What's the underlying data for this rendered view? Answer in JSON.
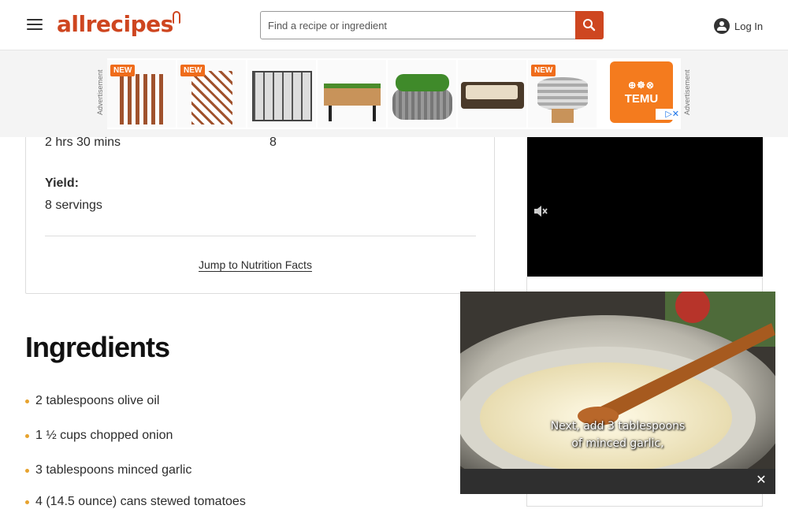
{
  "header": {
    "logo": "allrecipes",
    "search_placeholder": "Find a recipe or ingredient",
    "login_label": "Log In"
  },
  "ad": {
    "side_label": "Advertisement",
    "new_badge": "NEW",
    "brand": "TEMU",
    "brand_icons": "⊕☸⊗",
    "close_glyph": "▷✕",
    "colors": {
      "badge": "#ef6c1b",
      "brand_bg": "#f47b1e"
    }
  },
  "recipe": {
    "total_time_value": "2 hrs 30 mins",
    "servings_value": "8",
    "yield_label": "Yield:",
    "yield_value": "8 servings",
    "jump_link": "Jump to Nutrition Facts"
  },
  "ingredients": {
    "title": "Ingredients",
    "items": [
      "2 tablespoons olive oil",
      "1 ½ cups chopped onion",
      "3 tablespoons minced garlic",
      "4 (14.5 ounce) cans stewed tomatoes"
    ]
  },
  "video": {
    "caption_line1": "Next, add 3 tablespoons",
    "caption_line2": "of minced garlic,",
    "close_glyph": "✕"
  },
  "colors": {
    "brand": "#ce4620",
    "bullet": "#e7a32f"
  }
}
